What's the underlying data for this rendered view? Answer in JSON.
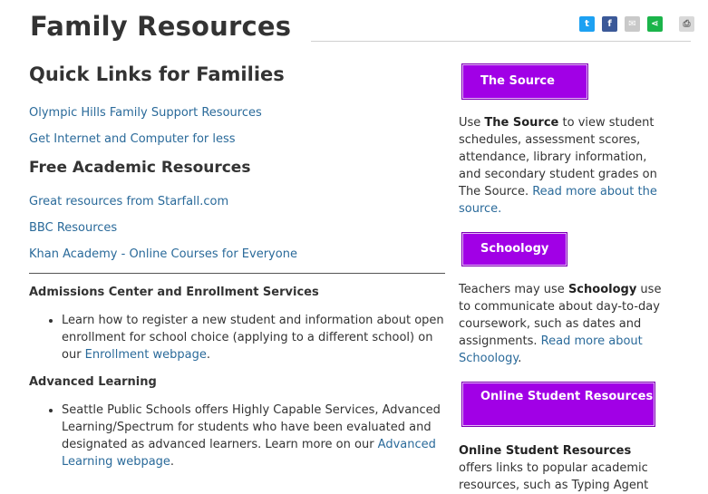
{
  "page": {
    "title": "Family Resources"
  },
  "share": {
    "twitter": "t",
    "facebook": "f",
    "email": "✉",
    "share": "⋖",
    "print": "⎙"
  },
  "left": {
    "quick_links_heading": "Quick Links for Families",
    "quick_links": [
      "Olympic Hills Family Support Resources",
      "Get Internet and Computer for less"
    ],
    "academic_heading": "Free Academic Resources",
    "academic_links": [
      "Great resources from Starfall.com",
      "BBC Resources",
      "Khan Academy - Online Courses for Everyone"
    ],
    "admissions": {
      "heading": "Admissions Center and Enrollment Services",
      "text_before": "Learn how to register a new student and information about open enrollment for school choice (applying to a different school) on our ",
      "link": "Enrollment webpage",
      "text_after": "."
    },
    "advanced": {
      "heading": "Advanced Learning",
      "text_before": "Seattle Public Schools offers Highly Capable Services, Advanced Learning/Spectrum for students who have been evaluated and designated as advanced learners. Learn more on our ",
      "link": "Advanced Learning webpage",
      "text_after": "."
    }
  },
  "right": {
    "source": {
      "button": "The Source",
      "text_1": "Use ",
      "bold": "The Source",
      "text_2": " to view student schedules, assessment scores, attendance, library information, and secondary student grades on The Source.",
      "link": "Read more about the source."
    },
    "schoology": {
      "button": "Schoology",
      "text_1": "Teachers may use ",
      "bold": "Schoology",
      "text_2": " use to communicate about day-to-day coursework, such as dates and assignments. ",
      "link": "Read more about Schoology",
      "text_3": "."
    },
    "online": {
      "button": "Online Student Resources",
      "bold": "Online Student Resources",
      "text_2": " offers links to popular academic resources, such as Typing Agent"
    }
  },
  "colors": {
    "button_purple": "#a100e6",
    "link_blue": "#2a6a9a",
    "twitter": "#1da1f2",
    "facebook": "#3b5998",
    "share_green": "#1bb44a"
  }
}
